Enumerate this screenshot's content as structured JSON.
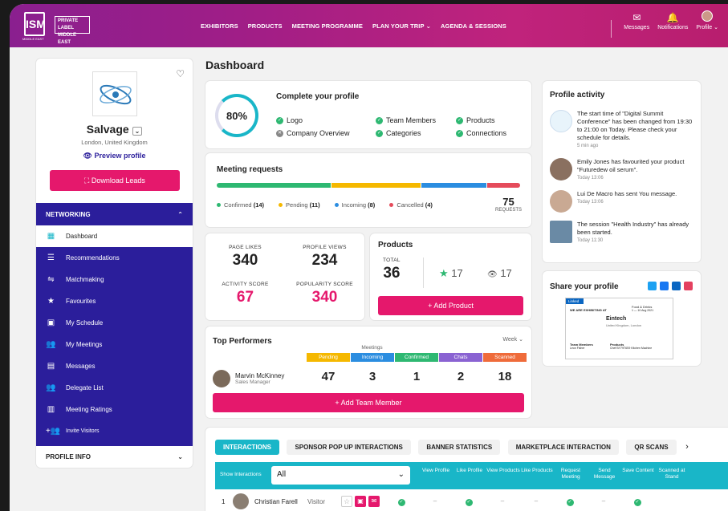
{
  "topbar": {
    "logo": "ISM",
    "logo_sub": "MIDDLE EAST",
    "logo2": "PRIVATE LABEL MIDDLE EAST",
    "nav": [
      "EXHIBITORS",
      "PRODUCTS",
      "MEETING PROGRAMME",
      "PLAN YOUR TRIP",
      "AGENDA & SESSIONS"
    ],
    "messages": "Messages",
    "notifications": "Notifications",
    "profile": "Profile"
  },
  "profile": {
    "name": "Salvage",
    "location": "London, United Kingdom",
    "preview": "Preview profile",
    "download": "Download Leads"
  },
  "menu": {
    "header": "NETWORKING",
    "items": [
      "Dashboard",
      "Recommendations",
      "Matchmaking",
      "Favourites",
      "My Schedule",
      "My Meetings",
      "Messages",
      "Delegate List",
      "Meeting Ratings",
      "Invite Visitors"
    ],
    "profile_info": "PROFILE INFO"
  },
  "page_title": "Dashboard",
  "complete": {
    "percent": "80%",
    "title": "Complete your profile",
    "items": [
      {
        "label": "Logo",
        "done": true
      },
      {
        "label": "Team Members",
        "done": true
      },
      {
        "label": "Products",
        "done": true
      },
      {
        "label": "Company Overview",
        "done": false
      },
      {
        "label": "Categories",
        "done": true
      },
      {
        "label": "Connections",
        "done": true
      }
    ]
  },
  "meetings": {
    "title": "Meeting requests",
    "confirmed_label": "Confirmed",
    "confirmed": "(14)",
    "pending_label": "Pending",
    "pending": "(11)",
    "incoming_label": "Incoming",
    "incoming": "(8)",
    "cancelled_label": "Cancelled",
    "cancelled": "(4)",
    "total": "75",
    "total_label": "REQUESTS",
    "colors": {
      "confirmed": "#2eb872",
      "pending": "#f5b800",
      "incoming": "#2b8de0",
      "cancelled": "#e54b5b"
    }
  },
  "stats": {
    "page_likes_label": "PAGE LIKES",
    "page_likes": "340",
    "profile_views_label": "PROFILE VIEWS",
    "profile_views": "234",
    "activity_label": "ACTIVITY SCORE",
    "activity": "67",
    "popularity_label": "POPULARITY SCORE",
    "popularity": "340"
  },
  "products": {
    "title": "Products",
    "total_label": "TOTAL",
    "total": "36",
    "stars": "17",
    "views": "17",
    "add": "+ Add Product"
  },
  "top": {
    "title": "Top Performers",
    "period": "Week",
    "meetings_label": "Meetings",
    "cols": [
      "Pending",
      "Incoming",
      "Confirmed",
      "Chats",
      "Scanned"
    ],
    "person": {
      "name": "Marvin McKinney",
      "role": "Sales Manager"
    },
    "values": [
      "47",
      "3",
      "1",
      "2",
      "18"
    ],
    "add": "+ Add Team Member"
  },
  "activity": {
    "title": "Profile activity",
    "items": [
      {
        "text": "The start time of \"Digital Summit Conference\" has been changed from 19:30 to 21:00 on Today. Please check your schedule for details.",
        "time": "5 min ago"
      },
      {
        "text": "Emily Jones has favourited your product \"Futuredew oil serum\".",
        "time": "Today 13:06"
      },
      {
        "text": "Lui De Macro has sent You message.",
        "time": "Today 13:06"
      },
      {
        "text": "The session \"Health Industry\" has already been started.",
        "time": "Today 11:30"
      }
    ]
  },
  "share": {
    "title": "Share your profile",
    "card": {
      "brand": "Linked",
      "exhibiting": "WE ARE EXHIBITING AT",
      "event": "Food & Drinks",
      "dates": "1 — 10 Aug 2021",
      "company": "Eintech",
      "company_loc": "United Kingdom, London",
      "team": "Team Members",
      "products": "Products",
      "person": "Leon Fisher",
      "product": "Chef BY79T6S9 Kitchen Machine"
    }
  },
  "tabs": [
    "INTERACTIONS",
    "SPONSOR POP UP INTERACTIONS",
    "BANNER STATISTICS",
    "MARKETPLACE INTERACTION",
    "QR SCANS"
  ],
  "interactions": {
    "show_label": "Show Interactions",
    "filter": "All",
    "cols": [
      "View Profile",
      "Like Profile",
      "View Products",
      "Like Products",
      "Request Meeting",
      "Send Message",
      "Save Content",
      "Scanned at Stand"
    ],
    "row": {
      "index": "1",
      "name": "Christian Farell",
      "type": "Visitor",
      "cells": [
        "ok",
        "–",
        "ok",
        "–",
        "–",
        "ok",
        "–",
        "ok"
      ]
    }
  }
}
